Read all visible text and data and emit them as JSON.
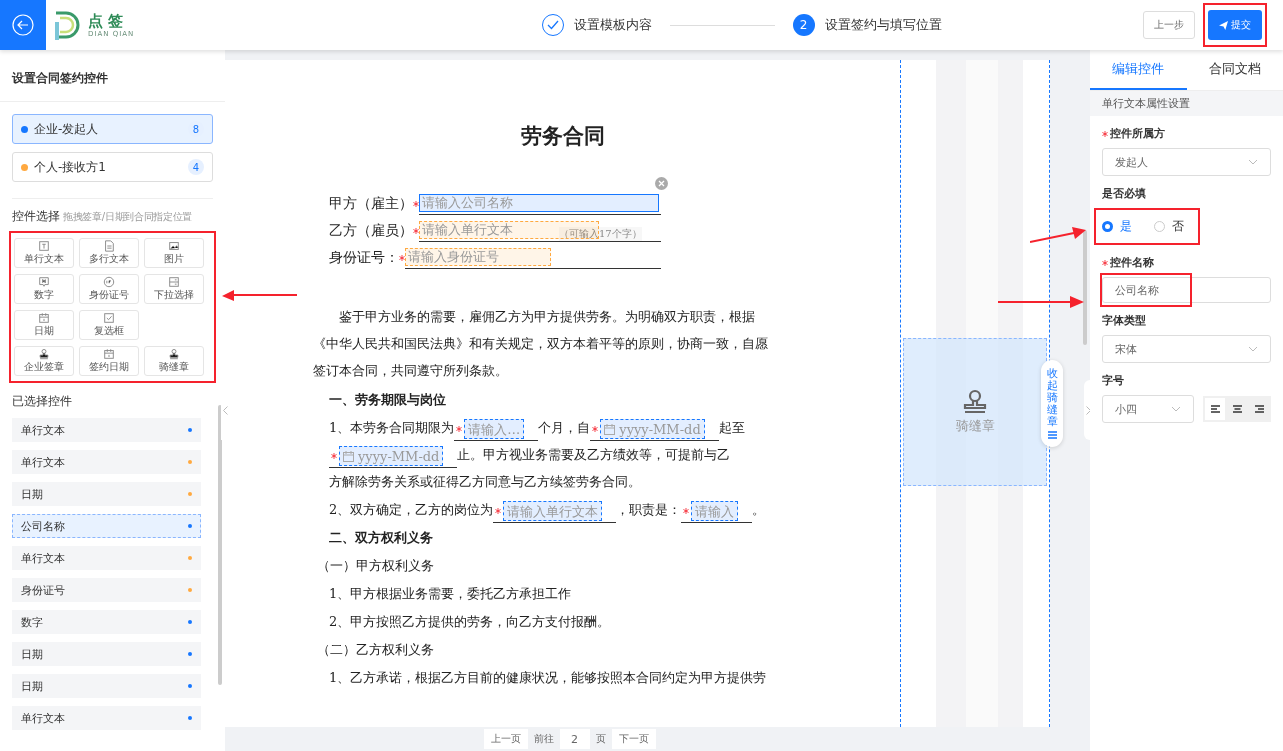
{
  "header": {
    "logo_title": "点 签",
    "logo_subtitle": "DIAN QIAN",
    "steps": [
      {
        "done": true,
        "label": "设置模板内容"
      },
      {
        "done": false,
        "number": "2",
        "label": "设置签约与填写位置"
      }
    ],
    "prev_button": "上一步",
    "submit_button": "提交"
  },
  "left_panel": {
    "title": "设置合同签约控件",
    "signers": [
      {
        "name": "企业-发起人",
        "count": "8",
        "color": "#1677ff",
        "selected": true
      },
      {
        "name": "个人-接收方1",
        "count": "4",
        "color": "#ffa940",
        "selected": false
      }
    ],
    "controls_title": "控件选择",
    "controls_hint": "拖拽签章/日期到合同指定位置",
    "control_rows": [
      [
        {
          "kind": "text",
          "label": "单行文本"
        },
        {
          "kind": "textarea",
          "label": "多行文本"
        },
        {
          "kind": "image",
          "label": "图片"
        }
      ],
      [
        {
          "kind": "number",
          "label": "数字"
        },
        {
          "kind": "idcard",
          "label": "身份证号"
        },
        {
          "kind": "select",
          "label": "下拉选择"
        }
      ],
      [
        {
          "kind": "date",
          "label": "日期"
        },
        {
          "kind": "checkbox",
          "label": "复选框"
        }
      ],
      [
        {
          "kind": "seal",
          "label": "企业签章"
        },
        {
          "kind": "date",
          "label": "签约日期"
        },
        {
          "kind": "seal",
          "label": "骑缝章"
        }
      ]
    ],
    "selected_title": "已选择控件",
    "selected_items": [
      {
        "label": "单行文本",
        "color": "#1677ff",
        "selected": false
      },
      {
        "label": "单行文本",
        "color": "#ffa940",
        "selected": false
      },
      {
        "label": "日期",
        "color": "#ffa940",
        "selected": false
      },
      {
        "label": "公司名称",
        "color": "#1677ff",
        "selected": true
      },
      {
        "label": "单行文本",
        "color": "#ffa940",
        "selected": false
      },
      {
        "label": "身份证号",
        "color": "#ffa940",
        "selected": false
      },
      {
        "label": "数字",
        "color": "#1677ff",
        "selected": false
      },
      {
        "label": "日期",
        "color": "#1677ff",
        "selected": false
      },
      {
        "label": "日期",
        "color": "#1677ff",
        "selected": false
      },
      {
        "label": "单行文本",
        "color": "#1677ff",
        "selected": false
      }
    ]
  },
  "document": {
    "title": "劳务合同",
    "parties": [
      {
        "label": "甲方（雇主）",
        "placeholder": "请输入公司名称",
        "color": "#1677ff",
        "required": true,
        "selected": true
      },
      {
        "label": "乙方（雇员）",
        "placeholder": "请输入单行文本",
        "hint": "（可输入17个字）",
        "color": "#ffa940",
        "required": true,
        "selected": false
      },
      {
        "label": "身份证号：",
        "placeholder": "请输入身份证号",
        "color": "#ffa940",
        "required": true,
        "selected": false
      }
    ],
    "blocks": [
      {
        "kind": "paragraph",
        "segments": [
          {
            "kind": "text",
            "text": "鉴于甲方业务的需要，雇佣乙方为甲方提供劳务。为明确双方职责，根据《中华人民共和国民法典》和有关规定，双方本着平等的原则，协商一致，自愿签订本合同，共同遵守所列条款。"
          }
        ]
      },
      {
        "kind": "heading",
        "text": "一、劳务期限与岗位"
      },
      {
        "kind": "clause",
        "segments": [
          {
            "kind": "text",
            "text": "1、本劳务合同期限为"
          },
          {
            "kind": "field",
            "placeholder": "请输入…",
            "color": "#1677ff",
            "required": true
          },
          {
            "kind": "text",
            "text": "个月，自"
          },
          {
            "kind": "date",
            "placeholder": "yyyy-MM-dd",
            "color": "#1677ff",
            "required": true
          },
          {
            "kind": "text",
            "text": "起至"
          },
          {
            "kind": "date",
            "placeholder": "yyyy-MM-dd",
            "color": "#1677ff",
            "required": true
          },
          {
            "kind": "text",
            "text": "止。甲方视业务需要及乙方绩效等，可提前与乙"
          },
          {
            "kind": "text",
            "text": "方解除劳务关系或征得乙方同意与乙方续签劳务合同。"
          }
        ]
      },
      {
        "kind": "clause",
        "segments": [
          {
            "kind": "text",
            "text": "2、双方确定，乙方的岗位为"
          },
          {
            "kind": "field",
            "placeholder": "请输入单行文本",
            "color": "#1677ff",
            "required": true
          },
          {
            "kind": "text",
            "text": "，职责是："
          },
          {
            "kind": "field",
            "placeholder": "请输入",
            "color": "#1677ff",
            "required": true
          },
          {
            "kind": "text",
            "text": "。"
          }
        ]
      },
      {
        "kind": "heading",
        "text": "二、双方权利义务"
      },
      {
        "kind": "line",
        "text": "（一）甲方权利义务"
      },
      {
        "kind": "clause",
        "segments": [
          {
            "kind": "text",
            "text": "1、甲方根据业务需要，委托乙方承担工作"
          }
        ]
      },
      {
        "kind": "clause",
        "segments": [
          {
            "kind": "text",
            "text": "2、甲方按照乙方提供的劳务，向乙方支付报酬。"
          }
        ]
      },
      {
        "kind": "line",
        "text": "（二）乙方权利义务"
      },
      {
        "kind": "clause",
        "segments": [
          {
            "kind": "text",
            "text": "1、乙方承诺，根据乙方目前的健康状况，能够按照本合同约定为甲方提供劳"
          }
        ]
      }
    ],
    "seam_stamp": "骑缝章",
    "seam_collapse": "收起骑缝章"
  },
  "pagination": {
    "prev": "上一页",
    "goto": "前往",
    "page": "2",
    "unit": "页",
    "next": "下一页"
  },
  "right_panel": {
    "tabs": [
      {
        "label": "编辑控件",
        "selected": true
      },
      {
        "label": "合同文档",
        "selected": false
      }
    ],
    "section_title": "单行文本属性设置",
    "owner": {
      "label": "控件所属方",
      "required": true,
      "value": "发起人"
    },
    "required_choice": {
      "label": "是否必填",
      "options": [
        {
          "label": "是",
          "selected": true
        },
        {
          "label": "否",
          "selected": false
        }
      ]
    },
    "name": {
      "label": "控件名称",
      "required": true,
      "value": "公司名称"
    },
    "font": {
      "label": "字体类型",
      "value": "宋体"
    },
    "size": {
      "label": "字号",
      "value": "小四",
      "aligns": [
        {
          "kind": "left",
          "selected": true
        },
        {
          "kind": "center",
          "selected": false
        },
        {
          "kind": "right",
          "selected": false
        }
      ]
    }
  }
}
